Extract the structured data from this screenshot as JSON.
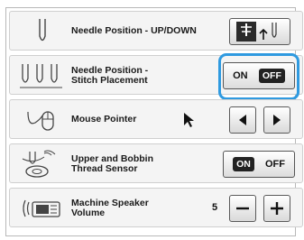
{
  "settings": [
    {
      "label_lines": [
        "Needle Position - UP/DOWN"
      ]
    },
    {
      "label_lines": [
        "Needle Position -",
        "Stitch Placement"
      ],
      "toggle": {
        "on": "ON",
        "off": "OFF",
        "selected": "OFF"
      }
    },
    {
      "label_lines": [
        "Mouse Pointer"
      ]
    },
    {
      "label_lines": [
        "Upper and Bobbin",
        "Thread Sensor"
      ],
      "toggle": {
        "on": "ON",
        "off": "OFF",
        "selected": "ON"
      }
    },
    {
      "label_lines": [
        "Machine Speaker",
        "Volume"
      ],
      "value": "5"
    }
  ],
  "icons": {
    "row1": "needle-icon",
    "row2": "needle-positions-icon",
    "row3": "mouse-icon",
    "row4": "thread-sensor-icon",
    "row5": "speaker-icon",
    "up_down_button": "needle-up-down-icon",
    "pointer": "arrow-pointer-icon",
    "left": "arrow-left-icon",
    "right": "arrow-right-icon",
    "minus": "minus-icon",
    "plus": "plus-icon"
  },
  "colors": {
    "highlight": "#2f9ae0"
  }
}
